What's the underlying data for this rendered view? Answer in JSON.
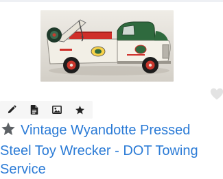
{
  "listing": {
    "title": "Vintage Wyandotte Pressed Steel Toy Wrecker - DOT Towing Service",
    "image_alt": "Vintage toy wrecker truck",
    "favorite_icon": "heart-icon"
  },
  "toolbar": {
    "icons": [
      "pencil-icon",
      "document-icon",
      "image-icon",
      "star-icon"
    ]
  },
  "colors": {
    "link": "#2b7bd6",
    "icon": "#222222",
    "title_star": "#5d6165",
    "heart": "#e3e3e3"
  }
}
